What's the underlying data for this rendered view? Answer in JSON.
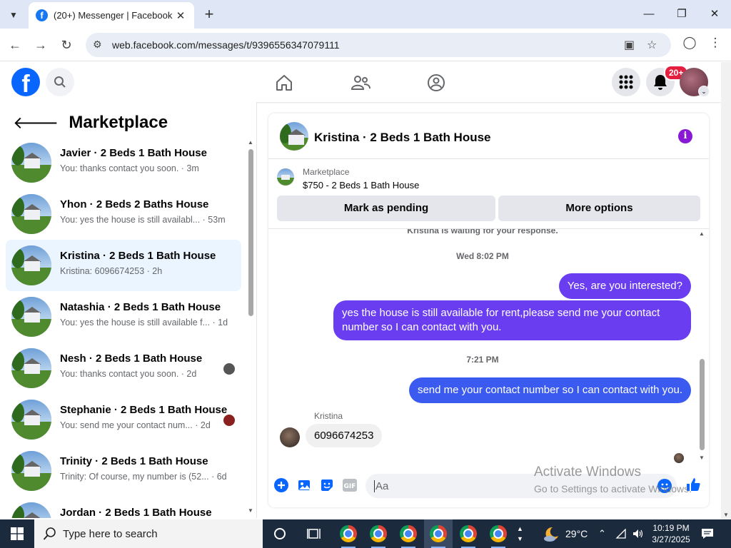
{
  "browser": {
    "tab_title": "(20+) Messenger | Facebook",
    "url": "web.facebook.com/messages/t/9396556347079111"
  },
  "facebook": {
    "notification_count": "20+"
  },
  "sidebar": {
    "title": "Marketplace",
    "conversations": [
      {
        "name": "Javier · 2 Beds 1 Bath House",
        "preview": "You: thanks contact you soon. · 3m",
        "active": false
      },
      {
        "name": "Yhon · 2 Beds 2 Baths House",
        "preview": "You: yes the house is still availabl... · 53m",
        "active": false
      },
      {
        "name": "Kristina · 2 Beds 1 Bath House",
        "preview": "Kristina: 6096674253 · 2h",
        "active": true
      },
      {
        "name": "Natashia · 2 Beds 1 Bath House",
        "preview": "You: yes the house is still available f... · 1d",
        "active": false
      },
      {
        "name": "Nesh · 2 Beds 1 Bath House",
        "preview": "You: thanks contact you soon. · 2d",
        "active": false
      },
      {
        "name": "Stephanie · 2 Beds 1 Bath House",
        "preview": "You: send me your contact num... · 2d",
        "active": false
      },
      {
        "name": "Trinity · 2 Beds 1 Bath House",
        "preview": "Trinity: Of course, my number is (52... · 6d",
        "active": false
      },
      {
        "name": "Jordan · 2 Beds 1 Bath House",
        "preview": "",
        "active": false
      }
    ]
  },
  "chat": {
    "title": "Kristina · 2 Beds 1 Bath House",
    "marketplace_label": "Marketplace",
    "listing": "$750 - 2 Beds 1 Bath House",
    "mark_pending_label": "Mark as pending",
    "more_options_label": "More options",
    "waiting_notice": "Kristina is waiting for your response.",
    "timestamp_1": "Wed 8:02 PM",
    "msg_1": "Yes, are you interested?",
    "msg_2": "yes the house is still available for rent,please send me your contact number so I can contact with you.",
    "timestamp_2": "7:21 PM",
    "msg_3": "send me your contact number so I can contact with you.",
    "incoming_sender": "Kristina",
    "incoming_msg": "6096674253",
    "composer_placeholder": "Aa"
  },
  "watermark": {
    "line1": "Activate Windows",
    "line2": "Go to Settings to activate Windows."
  },
  "taskbar": {
    "search_placeholder": "Type here to search",
    "weather": "29°C",
    "time": "10:19 PM",
    "date": "3/27/2025"
  },
  "colors": {
    "brand": "#0866ff",
    "outgoing_bubble": "#6a3df0",
    "active_row": "#ebf5ff"
  }
}
